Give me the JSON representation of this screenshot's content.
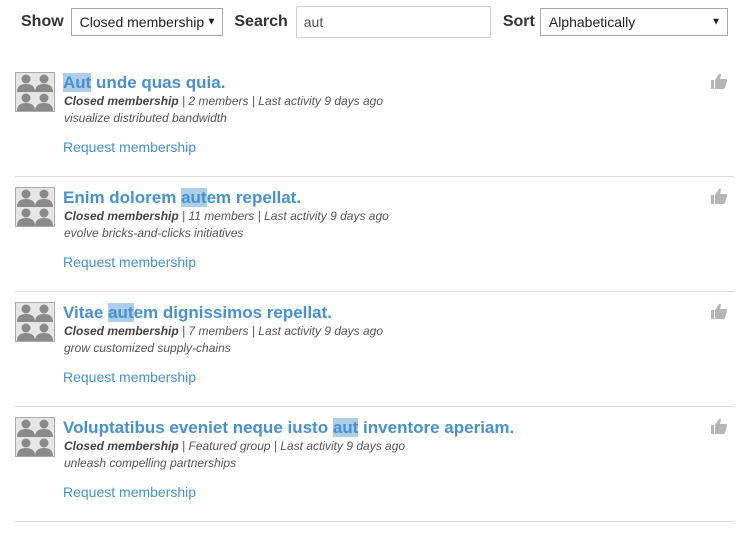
{
  "filters": {
    "show_label": "Show",
    "show_value": "Closed membership",
    "search_label": "Search",
    "search_value": "aut",
    "sort_label": "Sort",
    "sort_value": "Alphabetically"
  },
  "groups": [
    {
      "title_parts": [
        "",
        "Aut",
        " unde quas quia."
      ],
      "membership": "Closed membership",
      "detail": " | 2 members | Last activity 9 days ago",
      "description": "visualize distributed bandwidth",
      "action": "Request membership"
    },
    {
      "title_parts": [
        "Enim dolorem ",
        "aut",
        "em repellat."
      ],
      "membership": "Closed membership",
      "detail": " | 11 members | Last activity 9 days ago",
      "description": "evolve bricks-and-clicks initiatives",
      "action": "Request membership"
    },
    {
      "title_parts": [
        "Vitae ",
        "aut",
        "em dignissimos repellat."
      ],
      "membership": "Closed membership",
      "detail": " | 7 members | Last activity 9 days ago",
      "description": "grow customized supply-chains",
      "action": "Request membership"
    },
    {
      "title_parts": [
        "Voluptatibus eveniet neque iusto ",
        "aut",
        " inventore aperiam."
      ],
      "membership": "Closed membership",
      "detail": " | Featured group | Last activity 9 days ago",
      "description": "unleash compelling partnerships",
      "action": "Request membership"
    }
  ],
  "icons": {
    "avatar": "group-avatar-icon",
    "like": "thumbs-up-icon",
    "dropdown": "chevron-down-icon"
  },
  "colors": {
    "link": "#4690d6",
    "highlight": "#aecde8",
    "icon_grey": "#b5b5b5"
  }
}
